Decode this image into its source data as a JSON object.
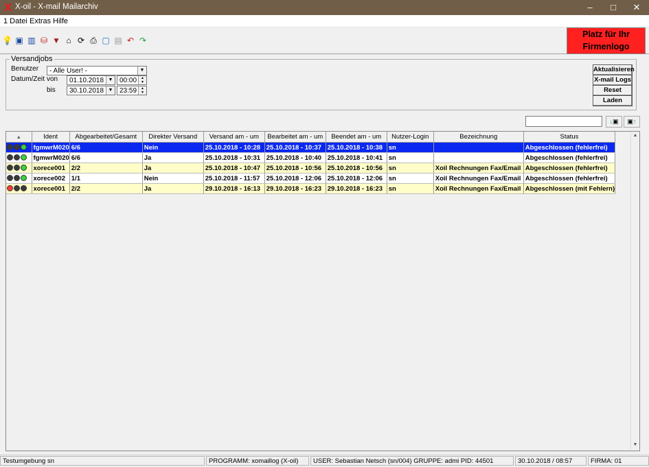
{
  "window": {
    "logo_glyph": "X",
    "title": "X-oil - X-mail Mailarchiv",
    "minimize": "–",
    "maximize": "□",
    "close": "✕"
  },
  "menu": [
    "1 Datei",
    "Extras",
    "Hilfe"
  ],
  "toolbar": {
    "icons": [
      "lightbulb-icon",
      "comment-icon",
      "book-icon",
      "database-icon",
      "filter-icon",
      "home-icon",
      "sync-icon",
      "print-icon",
      "window-icon",
      "save-icon",
      "undo-icon",
      "redo-icon"
    ],
    "logo_placeholder_line1": "Platz für Ihr",
    "logo_placeholder_line2": "Firmenlogo"
  },
  "filter": {
    "group_title": "Versandjobs",
    "user_label": "Benutzer",
    "user_value": "- Alle User! -",
    "datetime_label": "Datum/Zeit",
    "from_label": "von",
    "to_label": "bis",
    "from_date": "01.10.2018",
    "from_time": "00:00",
    "to_date": "30.10.2018",
    "to_time": "23:59"
  },
  "buttons": {
    "refresh": "Aktualisieren",
    "logs": "X-mail Logs",
    "reset": "Reset",
    "load": "Laden"
  },
  "search": {
    "value": "",
    "find_down": "↓",
    "find_up": "↑"
  },
  "table": {
    "sort_glyph": "▲",
    "columns": [
      "Ident",
      "Abgearbeitet/Gesamt",
      "Direkter Versand",
      "Versand am - um",
      "Bearbeitet am - um",
      "Beendet am - um",
      "Nutzer-Login",
      "Bezeichnung",
      "Status"
    ],
    "rows": [
      {
        "lights": "green",
        "cells": [
          "fgmwrM020",
          "6/6",
          "Nein",
          "25.10.2018 - 10:28",
          "25.10.2018 - 10:37",
          "25.10.2018 - 10:38",
          "sn",
          "",
          "Abgeschlossen (fehlerfrei)"
        ],
        "style": "selected"
      },
      {
        "lights": "green",
        "cells": [
          "fgmwrM020",
          "6/6",
          "Ja",
          "25.10.2018 - 10:31",
          "25.10.2018 - 10:40",
          "25.10.2018 - 10:41",
          "sn",
          "",
          "Abgeschlossen (fehlerfrei)"
        ],
        "style": "white"
      },
      {
        "lights": "green",
        "cells": [
          "xorece001",
          "2/2",
          "Ja",
          "25.10.2018 - 10:47",
          "25.10.2018 - 10:56",
          "25.10.2018 - 10:56",
          "sn",
          "Xoil Rechnungen Fax/Email",
          "Abgeschlossen (fehlerfrei)"
        ],
        "style": "yellow"
      },
      {
        "lights": "green",
        "cells": [
          "xorece002",
          "1/1",
          "Nein",
          "25.10.2018 - 11:57",
          "25.10.2018 - 12:06",
          "25.10.2018 - 12:06",
          "sn",
          "Xoil Rechnungen Fax/Email",
          "Abgeschlossen (fehlerfrei)"
        ],
        "style": "white"
      },
      {
        "lights": "red",
        "cells": [
          "xorece001",
          "2/2",
          "Ja",
          "29.10.2018 - 16:13",
          "29.10.2018 - 16:23",
          "29.10.2018 - 16:23",
          "sn",
          "Xoil Rechnungen Fax/Email",
          "Abgeschlossen (mit Fehlern)"
        ],
        "style": "yellow"
      }
    ]
  },
  "scroll": {
    "up": "▲",
    "down": "▼"
  },
  "status": {
    "env": "Testumgebung sn",
    "program": "PROGRAMM: xomaillog (X-oil)",
    "user": "USER: Sebastian Netsch (sn/004)  GRUPPE: admi  PID: 44501",
    "datetime": "30.10.2018 / 08:57",
    "firma": "FIRMA: 01"
  },
  "colors": {
    "selected": "#0a28f0",
    "yellow": "#fffdc8",
    "white": "#ffffff",
    "green": "#3cd23c",
    "red": "#ff3c3c",
    "dark": "#3a3a3a"
  }
}
